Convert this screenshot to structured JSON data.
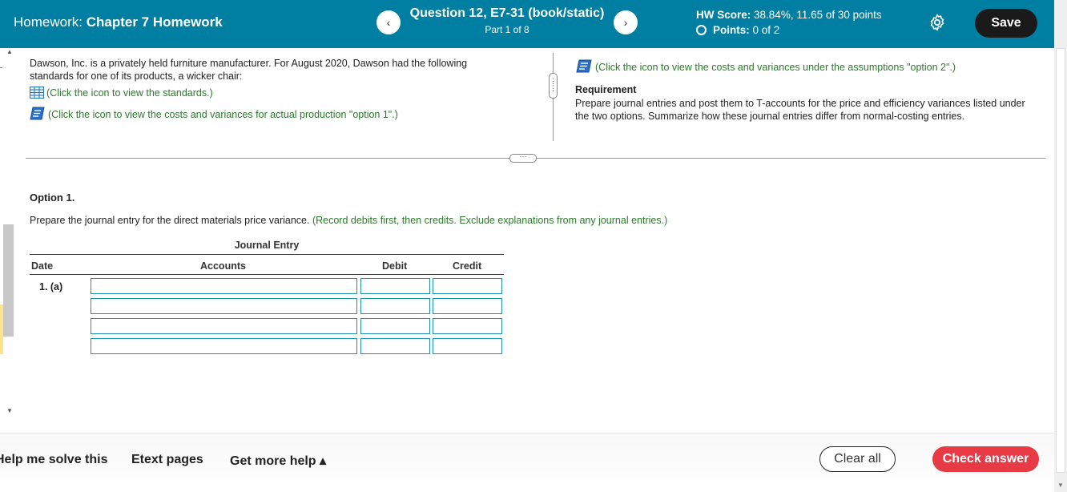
{
  "header": {
    "homework_label": "Homework:",
    "homework_name": "Chapter 7 Homework",
    "prev_icon": "chevron-left-icon",
    "next_icon": "chevron-right-icon",
    "question_title": "Question 12, E7-31 (book/static)",
    "part": "Part 1 of 8",
    "score_label": "HW Score:",
    "score_value": "38.84%, 11.65 of 30 points",
    "points_label": "Points:",
    "points_value": "0 of 2",
    "settings_icon": "gear-icon",
    "save_label": "Save",
    "background_color": "#007FA3"
  },
  "problem": {
    "intro": "Dawson, Inc. is a privately held furniture manufacturer. For August 2020, Dawson had the following standards for one of its products, a wicker chair:",
    "standards_link": "(Click the icon to view the standards.)",
    "option1_link": "(Click the icon to view the costs and variances for actual production \"option 1\".)",
    "option2_link": "(Click the icon to view the costs and variances under the assumptions \"option 2\".)",
    "requirement_heading": "Requirement",
    "requirement_text": "Prepare journal entries and post them to T-accounts for the price and efficiency variances listed under the two options. Summarize how these journal entries differ from normal-costing entries."
  },
  "question": {
    "option_title": "Option 1.",
    "instruction": "Prepare the journal entry for the direct materials price variance.",
    "instruction_hint": "(Record debits first, then credits. Exclude explanations from any journal entries.)"
  },
  "journal": {
    "title": "Journal Entry",
    "col_date": "Date",
    "col_accounts": "Accounts",
    "col_debit": "Debit",
    "col_credit": "Credit",
    "date_value": "1. (a)",
    "rows": [
      {
        "account": "",
        "debit": "",
        "credit": ""
      },
      {
        "account": "",
        "debit": "",
        "credit": ""
      },
      {
        "account": "",
        "debit": "",
        "credit": ""
      },
      {
        "account": "",
        "debit": "",
        "credit": ""
      }
    ]
  },
  "footer": {
    "help_solve": "Help me solve this",
    "etext": "Etext pages",
    "more_help": "Get more help ▴",
    "clear_all": "Clear all",
    "check_answer": "Check answer",
    "check_color": "#e83a45"
  }
}
